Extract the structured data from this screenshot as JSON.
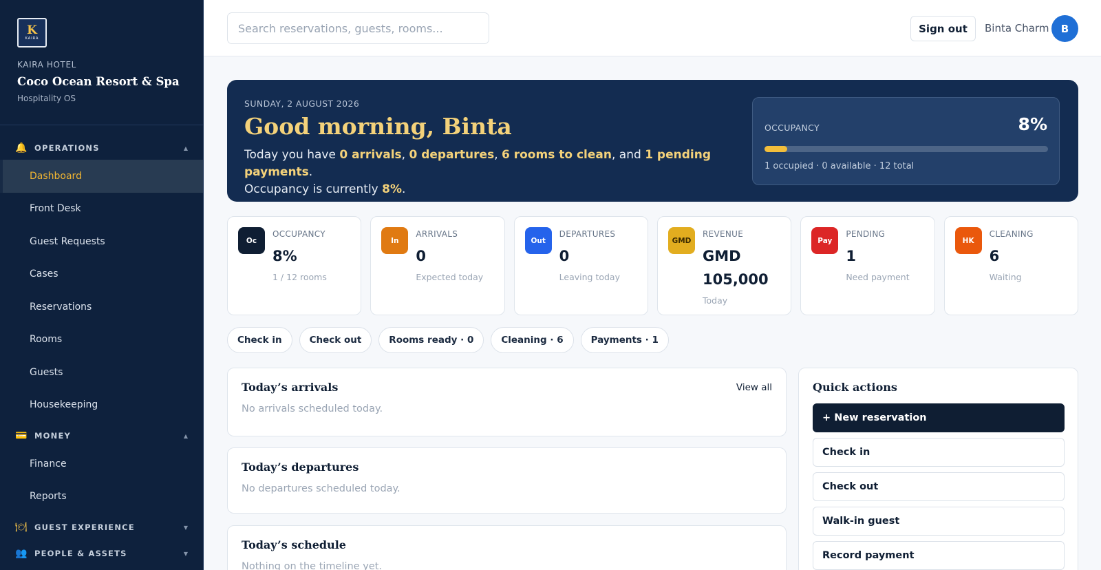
{
  "brand": {
    "logo_mark": "K",
    "logo_text": "KAIRA",
    "kicker": "KAIRA HOTEL",
    "name": "Coco Ocean Resort & Spa",
    "subtitle": "Hospitality OS"
  },
  "sidebar": {
    "sections": [
      {
        "label": "OPERATIONS",
        "icon": "bell-icon",
        "items": [
          "Dashboard",
          "Front Desk",
          "Guest Requests",
          "Cases",
          "Reservations",
          "Rooms",
          "Guests",
          "Housekeeping"
        ]
      },
      {
        "label": "MONEY",
        "icon": "card-icon",
        "items": [
          "Finance",
          "Reports"
        ]
      },
      {
        "label": "GUEST EXPERIENCE",
        "icon": "plate-icon",
        "items": []
      },
      {
        "label": "PEOPLE & ASSETS",
        "icon": "people-icon",
        "items": []
      }
    ],
    "active_item": "Dashboard"
  },
  "topbar": {
    "search_placeholder": "Search reservations, guests, rooms...",
    "sign_out": "Sign out",
    "user_name": "Binta Charm",
    "avatar_initial": "B"
  },
  "hero": {
    "date": "SUNDAY, 2 AUGUST 2026",
    "greeting": "Good morning, Binta",
    "t1": "Today you have ",
    "arrivals": "0 arrivals",
    "t2": ", ",
    "departures": "0 departures",
    "t3": ", ",
    "rooms_to_clean": "6 rooms to clean",
    "t4": ", and ",
    "pending": "1 pending payments",
    "t5": ".",
    "t6": "Occupancy is currently ",
    "occupancy": "8%",
    "t7": ".",
    "occupancy_card": {
      "label": "OCCUPANCY",
      "value": "8%",
      "fill_percent": 8,
      "meta": "1 occupied · 0 available · 12 total"
    }
  },
  "stats": [
    {
      "badge": "Oc",
      "color": "#0f1e33",
      "label": "OCCUPANCY",
      "value": "8%",
      "sub": "1 / 12 rooms"
    },
    {
      "badge": "In",
      "color": "#e07a12",
      "label": "ARRIVALS",
      "value": "0",
      "sub": "Expected today"
    },
    {
      "badge": "Out",
      "color": "#2563eb",
      "label": "DEPARTURES",
      "value": "0",
      "sub": "Leaving today"
    },
    {
      "badge": "GMD",
      "color": "#e2ad1f",
      "label": "REVENUE",
      "value": "GMD 105,000",
      "sub": "Today"
    },
    {
      "badge": "Pay",
      "color": "#dc2626",
      "label": "PENDING",
      "value": "1",
      "sub": "Need payment"
    },
    {
      "badge": "HK",
      "color": "#ea580c",
      "label": "CLEANING",
      "value": "6",
      "sub": "Waiting"
    }
  ],
  "chips": [
    "Check in",
    "Check out",
    "Rooms ready · 0",
    "Cleaning · 6",
    "Payments · 1"
  ],
  "panels": {
    "arrivals": {
      "title": "Today’s arrivals",
      "empty": "No arrivals scheduled today.",
      "action": "View all"
    },
    "departures": {
      "title": "Today’s departures",
      "empty": "No departures scheduled today."
    },
    "schedule": {
      "title": "Today’s schedule",
      "empty": "Nothing on the timeline yet."
    }
  },
  "quick_actions": {
    "title": "Quick actions",
    "items": [
      "+ New reservation",
      "Check in",
      "Check out",
      "Walk-in guest",
      "Record payment"
    ]
  }
}
